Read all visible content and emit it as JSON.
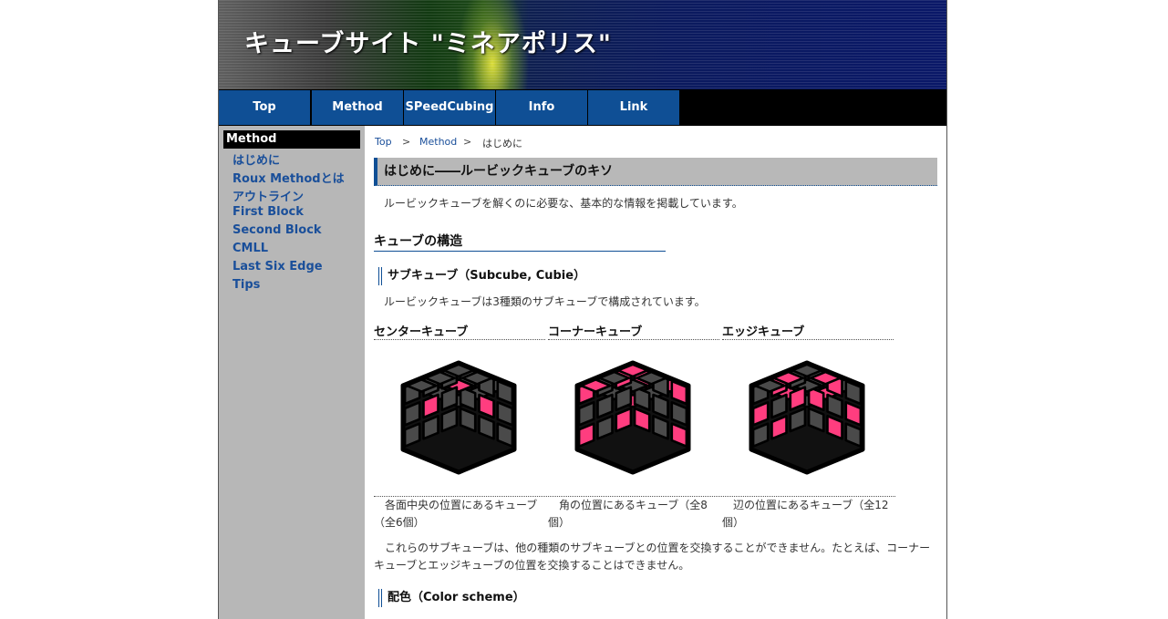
{
  "site": {
    "title": "キューブサイト \"ミネアポリス\""
  },
  "nav": [
    "Top",
    "Method",
    "SPeedCubing",
    "Info",
    "Link"
  ],
  "sidebar": {
    "heading": "Method",
    "items": [
      "はじめに",
      "Roux Methodとは",
      "アウトライン",
      "First Block",
      "Second Block",
      "CMLL",
      "Last Six Edge",
      "Tips"
    ]
  },
  "breadcrumb": {
    "items": [
      "Top",
      "Method",
      "はじめに"
    ],
    "separator": ">"
  },
  "page": {
    "title": "はじめに――ルービックキューブのキソ",
    "intro": "ルービックキューブを解くのに必要な、基本的な情報を掲載しています。",
    "section_structure": "キューブの構造",
    "subcube_heading": "サブキューブ（Subcube, Cubie）",
    "subcube_text": "ルービックキューブは3種類のサブキューブで構成されています。",
    "cubes": [
      {
        "label": "センターキューブ",
        "caption": "各面中央の位置にあるキューブ（全6個）",
        "icon": "center-cube-illustration"
      },
      {
        "label": "コーナーキューブ",
        "caption": "角の位置にあるキューブ（全8個）",
        "icon": "corner-cube-illustration"
      },
      {
        "label": "エッジキューブ",
        "caption": "辺の位置にあるキューブ（全12個）",
        "icon": "edge-cube-illustration"
      }
    ],
    "exchange_text": "これらのサブキューブは、他の種類のサブキューブとの位置を交換することができません。たとえば、コーナーキューブとエッジキューブの位置を交換することはできません。",
    "color_heading": "配色（Color scheme）"
  },
  "colors": {
    "nav_bg": "#0f4f95",
    "link": "#1a4f9a",
    "highlight": "#ff3d7f",
    "sticker_dark": "#4a4a4a",
    "sidebar_bg": "#b7b7b7"
  }
}
